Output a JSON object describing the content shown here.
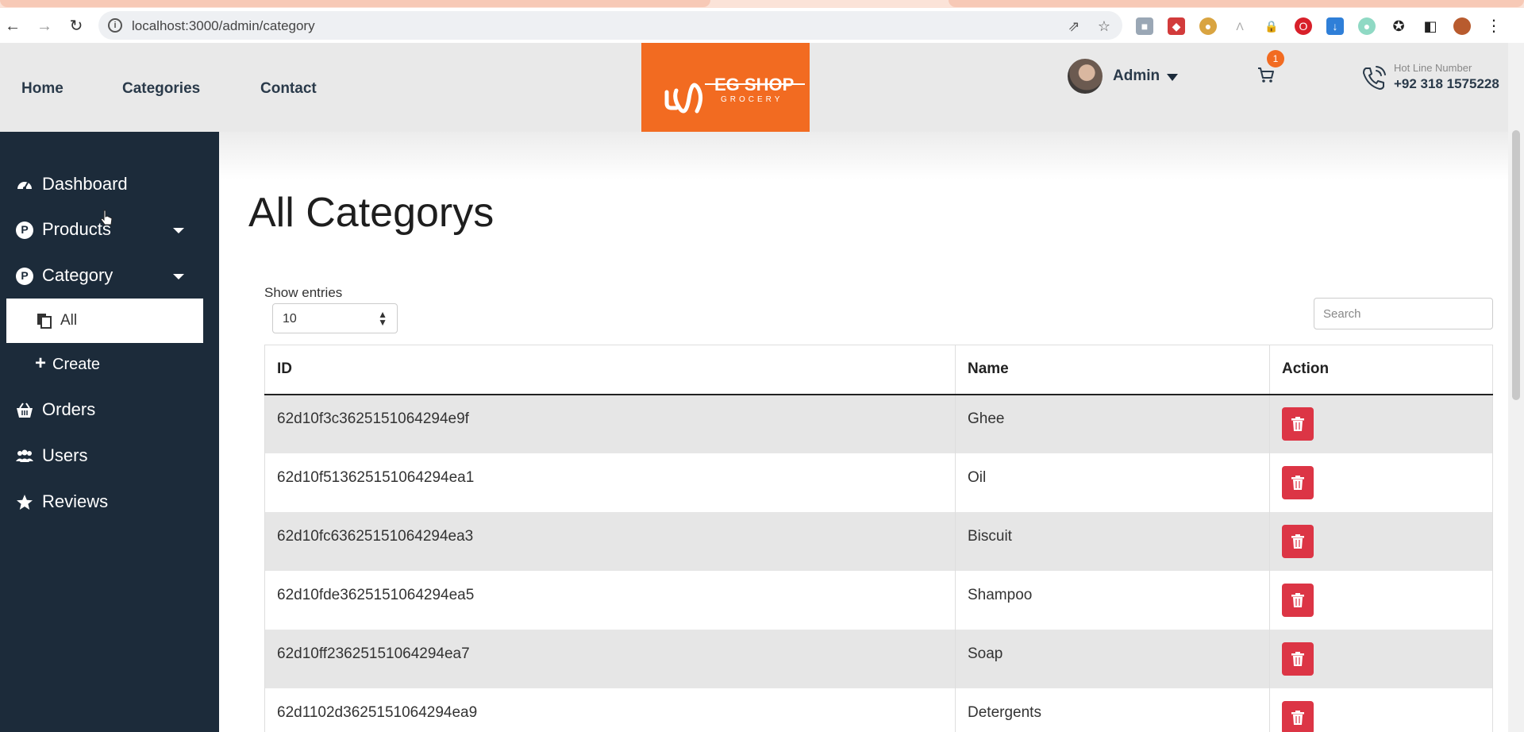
{
  "browser": {
    "url": "localhost:3000/admin/category"
  },
  "header": {
    "nav": [
      "Home",
      "Categories",
      "Contact"
    ],
    "logo_text": "EG SHOP",
    "logo_sub": "GROCERY",
    "admin_label": "Admin",
    "cart_count": "1",
    "hotline_label": "Hot Line Number",
    "hotline_number": "+92 318 1575228"
  },
  "sidebar": {
    "items": [
      {
        "label": "Dashboard",
        "icon": "dashboard-icon"
      },
      {
        "label": "Products",
        "icon": "product-icon"
      },
      {
        "label": "Category",
        "icon": "category-icon"
      },
      {
        "label": "Orders",
        "icon": "basket-icon"
      },
      {
        "label": "Users",
        "icon": "users-icon"
      },
      {
        "label": "Reviews",
        "icon": "star-icon"
      }
    ],
    "category_sub": {
      "all": "All",
      "create": "Create"
    }
  },
  "main": {
    "title": "All Categorys",
    "show_entries_label": "Show entries",
    "entries_value": "10",
    "search_placeholder": "Search",
    "columns": [
      "ID",
      "Name",
      "Action"
    ],
    "rows": [
      {
        "id": "62d10f3c3625151064294e9f",
        "name": "Ghee"
      },
      {
        "id": "62d10f513625151064294ea1",
        "name": "Oil"
      },
      {
        "id": "62d10fc63625151064294ea3",
        "name": "Biscuit"
      },
      {
        "id": "62d10fde3625151064294ea5",
        "name": "Shampoo"
      },
      {
        "id": "62d10ff23625151064294ea7",
        "name": "Soap"
      },
      {
        "id": "62d1102d3625151064294ea9",
        "name": "Detergents"
      }
    ]
  },
  "colors": {
    "brand_orange": "#f26b21",
    "sidebar_bg": "#1c2b3a",
    "delete_red": "#dc3545"
  }
}
